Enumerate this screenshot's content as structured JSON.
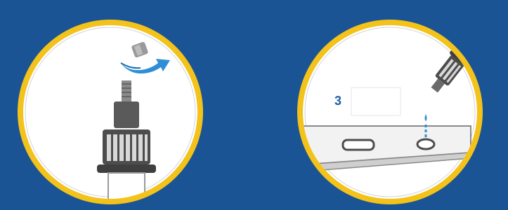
{
  "colors": {
    "background": "#1a5494",
    "ring": "#f3c21b",
    "circle_fill": "#ffffff",
    "arrow": "#2e8fd6",
    "drop": "#2e8fd6",
    "device": "#4d4d4d"
  },
  "steps": [
    {
      "icon": "remove-cap-icon",
      "label": ""
    },
    {
      "icon": "add-drops-icon",
      "label": "3"
    }
  ]
}
